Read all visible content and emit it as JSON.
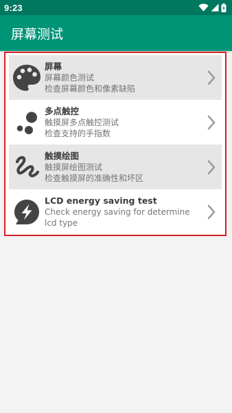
{
  "status_bar": {
    "time": "9:23",
    "icons": [
      "wifi-icon",
      "cell-signal-icon",
      "battery-icon"
    ]
  },
  "toolbar": {
    "title": "屏幕测试"
  },
  "items": [
    {
      "icon": "palette-icon",
      "title": "屏幕",
      "line1": "屏幕颜色测试",
      "line2": "检查屏幕颜色和像素缺陷"
    },
    {
      "icon": "multitouch-dots-icon",
      "title": "多点触控",
      "line1": "触摸屏多点触控测试",
      "line2": "检查支持的手指数"
    },
    {
      "icon": "scribble-icon",
      "title": "触摸绘图",
      "line1": "触摸屏绘图测试",
      "line2": "检查触摸屏的准确性和坏区"
    },
    {
      "icon": "energy-bolt-icon",
      "title": "LCD energy saving test",
      "line1": "Check energy saving for determine",
      "line2": "lcd type"
    }
  ],
  "colors": {
    "status_bar": "#00775f",
    "toolbar": "#009477",
    "highlight_border": "#d42127",
    "icon": "#444444",
    "chevron": "#9e9e9e"
  }
}
